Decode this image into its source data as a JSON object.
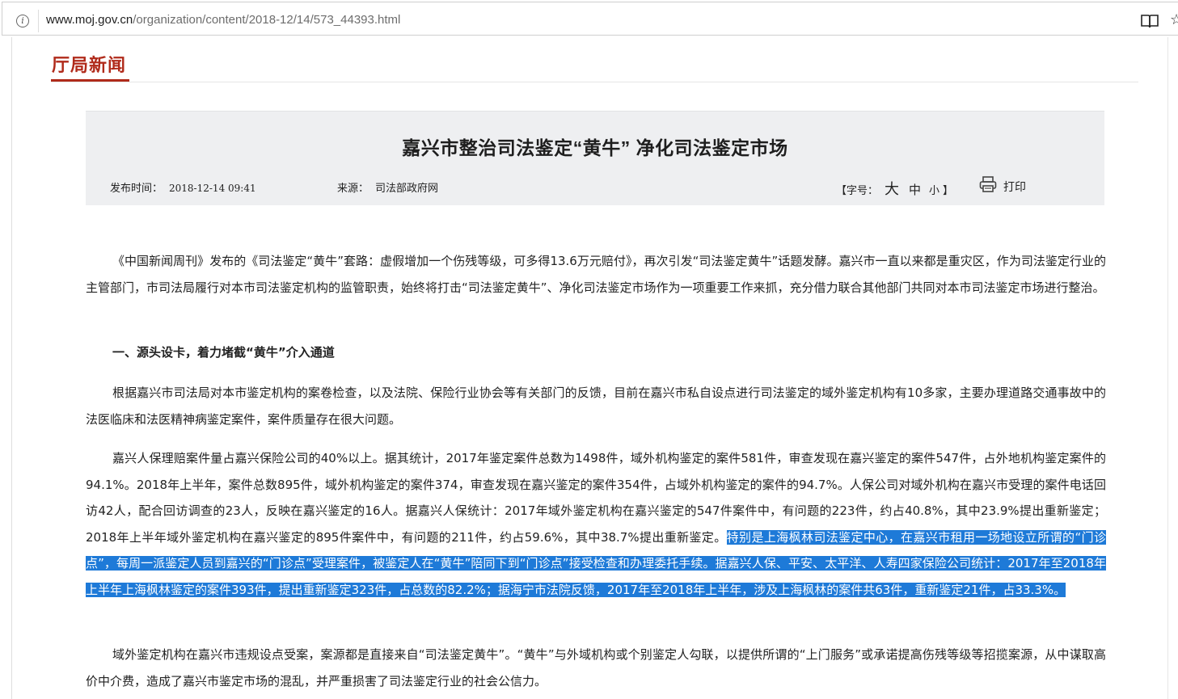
{
  "browser": {
    "url_host": "www.moj.gov.cn",
    "url_path": "/organization/content/2018-12/14/573_44393.html",
    "icons": [
      "info-icon",
      "reader-mode-icon",
      "favorite-star-icon"
    ]
  },
  "section": {
    "title": "厅局新闻"
  },
  "article": {
    "title": "嘉兴市整治司法鉴定“黄牛” 净化司法鉴定市场",
    "date_label": "发布时间：",
    "date_value": "2018-12-14 09:41",
    "source_label": "来源：",
    "source_value": "司法部政府网",
    "font_size_open": "【字号：",
    "font_size_big": "大",
    "font_size_mid": "中",
    "font_size_small": "小",
    "font_size_close": "】",
    "print_label": "打印"
  },
  "paragraphs": {
    "p1": "《中国新闻周刊》发布的《司法鉴定“黄牛”套路：虚假增加一个伤残等级，可多得13.6万元赔付》，再次引发“司法鉴定黄牛”话题发酵。嘉兴市一直以来都是重灾区，作为司法鉴定行业的主管部门，市司法局履行对本市司法鉴定机构的监管职责，始终将打击“司法鉴定黄牛”、净化司法鉴定市场作为一项重要工作来抓，充分借力联合其他部门共同对本市司法鉴定市场进行整治。",
    "h1": "一、源头设卡，着力堵截“黄牛”介入通道",
    "p2": "根据嘉兴市司法局对本市鉴定机构的案卷检查，以及法院、保险行业协会等有关部门的反馈，目前在嘉兴市私自设点进行司法鉴定的域外鉴定机构有10多家，主要办理道路交通事故中的法医临床和法医精神病鉴定案件，案件质量存在很大问题。",
    "p3_a": "嘉兴人保理赔案件量占嘉兴保险公司的40%以上。据其统计，2017年鉴定案件总数为1498件，域外机构鉴定的案件581件，审查发现在嘉兴鉴定的案件547件，占外地机构鉴定案件的94.1%。2018年上半年，案件总数895件，域外机构鉴定的案件374，审查发现在嘉兴鉴定的案件354件，占域外机构鉴定的案件的94.7%。人保公司对域外机构在嘉兴市受理的案件电话回访42人，配合回访调查的23人，反映在嘉兴鉴定的16人。据嘉兴人保统计：2017年域外鉴定机构在嘉兴鉴定的547件案件中，有问题的223件，约占40.8%，其中23.9%提出重新鉴定；2018年上半年域外鉴定机构在嘉兴鉴定的895件案件中，有问题的211件，约占59.6%，其中38.7%提出重新鉴定。",
    "p3_b": "特别是上海枫林司法鉴定中心，在嘉兴市租用一场地设立所谓的“门诊点”，每周一派鉴定人员到嘉兴的“门诊点”受理案件，被鉴定人在“黄牛”陪同下到“门诊点”接受检查和办理委托手续。据嘉兴人保、平安、太平洋、人寿四家保险公司统计：2017年至2018年上半年上海枫林鉴定的案件393件，提出重新鉴定323件，占总数的82.2%；据海宁市法院反馈，2017年至2018年上半年，涉及上海枫林的案件共63件，重新鉴定21件，占33.3%。",
    "p4": "域外鉴定机构在嘉兴市违规设点受案，案源都是直接来自“司法鉴定黄牛”。“黄牛”与外域机构或个别鉴定人勾联，以提供所谓的“上门服务”或承诺提高伤残等级等招揽案源，从中谋取高价中介费，造成了嘉兴市鉴定市场的混乱，并严重损害了司法鉴定行业的社会公信力。"
  }
}
